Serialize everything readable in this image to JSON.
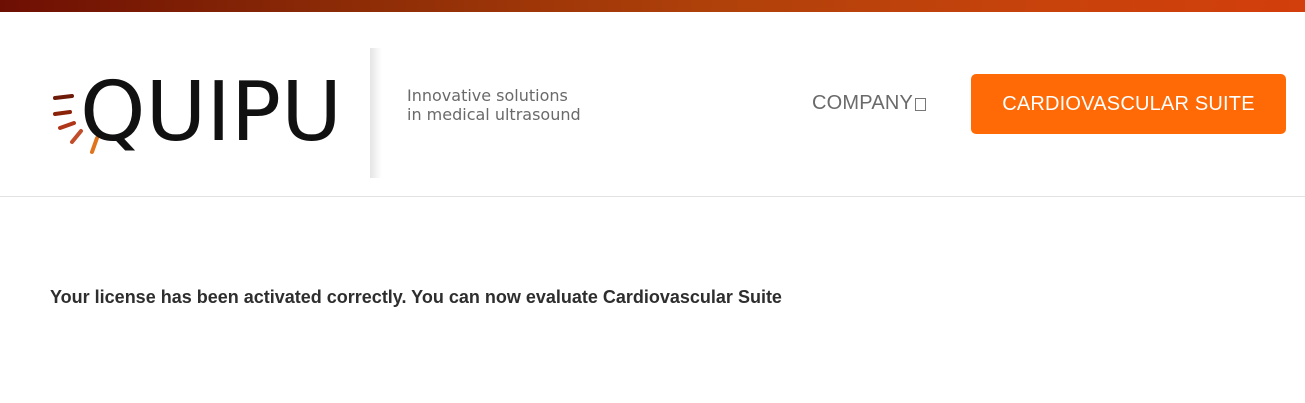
{
  "brand": {
    "logo_text": "QUIPU",
    "tagline_line1": "Innovative solutions",
    "tagline_line2": "in medical ultrasound",
    "logo_icon": "sunburst-icon",
    "accent_color": "#ff6a07",
    "top_bar_color": "#b0410a"
  },
  "nav": {
    "company_label": "COMPANY",
    "company_icon": "dropdown-box-icon",
    "cta_label": "CARDIOVASCULAR SUITE"
  },
  "main": {
    "message": "Your license has been activated correctly. You can now evaluate Cardiovascular Suite"
  }
}
